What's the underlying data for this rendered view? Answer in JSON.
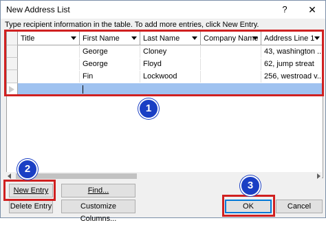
{
  "window": {
    "title": "New Address List",
    "help": "?",
    "close": "✕"
  },
  "instruction": "Type recipient information in the table. To add more entries, click New Entry.",
  "table": {
    "columns": [
      "Title",
      "First Name",
      "Last Name",
      "Company Name",
      "Address Line 1"
    ],
    "rows": [
      [
        "",
        "George",
        "Cloney",
        "",
        "43, washington ..."
      ],
      [
        "",
        "George",
        "Floyd",
        "",
        "62, jump streat"
      ],
      [
        "",
        "Fin",
        "Lockwood",
        "",
        "256, westroad v..."
      ]
    ]
  },
  "buttons": {
    "new_entry": "New Entry",
    "find": "Find...",
    "delete_entry": "Delete Entry",
    "customize_columns": "Customize Columns...",
    "ok": "OK",
    "cancel": "Cancel"
  },
  "callouts": [
    "1",
    "2",
    "3"
  ],
  "colors": {
    "highlight": "#d02020",
    "badge": "#1a3fc4",
    "selected_row": "#9fc2f0"
  }
}
